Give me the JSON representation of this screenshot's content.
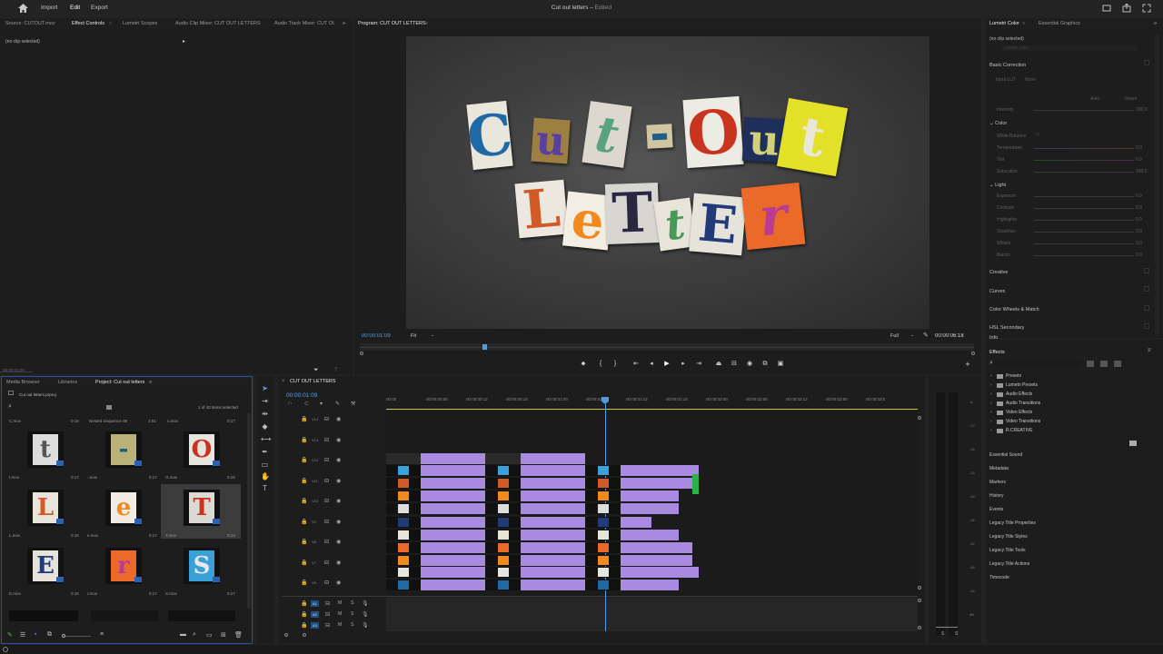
{
  "header": {
    "nav": [
      "Import",
      "Edit",
      "Export"
    ],
    "title": "Cut out letters",
    "title_status": "Edited"
  },
  "source_tabs": [
    "Source: CUTOUT.mov",
    "Effect Controls",
    "Lumetri Scopes",
    "Audio Clip Mixer: CUT OUT LETTERS",
    "Audio Track Mixer: CUT OUT"
  ],
  "effect_controls": {
    "no_clip": "(no clip selected)",
    "timecode": "00:00:01:09"
  },
  "program": {
    "tab": "Program: CUT OUT LETTERS",
    "timecode": "00:00:01:09",
    "fit": "Fit",
    "quality": "Full",
    "duration": "00:00:06:18",
    "words": [
      "Cut",
      "Out",
      "Letter"
    ]
  },
  "lumetri": {
    "tabs": [
      "Lumetri Color",
      "Essential Graphics"
    ],
    "no_clip": "(no clip selected)",
    "clip_field": "Lumetri Color",
    "basic_correction": "Basic Correction",
    "input_lut_label": "Input LUT",
    "input_lut_value": "None",
    "auto_btn": "Auto",
    "reset_btn": "Reset",
    "intensity_label": "Intensity",
    "intensity_value": "100.0",
    "color_section": "Color",
    "white_balance": "White Balance",
    "color_rows": [
      {
        "label": "Temperature",
        "value": "0.0"
      },
      {
        "label": "Tint",
        "value": "0.0"
      },
      {
        "label": "Saturation",
        "value": "100.0"
      }
    ],
    "light_section": "Light",
    "light_rows": [
      {
        "label": "Exposure",
        "value": "0.0"
      },
      {
        "label": "Contrast",
        "value": "0.0"
      },
      {
        "label": "Highlights",
        "value": "0.0"
      },
      {
        "label": "Shadows",
        "value": "0.0"
      },
      {
        "label": "Whites",
        "value": "0.0"
      },
      {
        "label": "Blacks",
        "value": "0.0"
      }
    ],
    "sections": [
      "Creative",
      "Curves",
      "Color Wheels & Match",
      "HSL Secondary"
    ]
  },
  "right_panel": {
    "info": "Info",
    "effects": "Effects",
    "effects_tree": [
      "Presets",
      "Lumetri Presets",
      "Audio Effects",
      "Audio Transitions",
      "Video Effects",
      "Video Transitions",
      "R.CREATIVE"
    ],
    "panels": [
      "Essential Sound",
      "Metadata",
      "Markers",
      "History",
      "Events",
      "Legacy Title Properties",
      "Legacy Title Styles",
      "Legacy Title Tools",
      "Legacy Title Actions",
      "Timecode"
    ]
  },
  "project": {
    "tabs": [
      "Media Browser",
      "Libraries",
      "Project: Cut out letters"
    ],
    "file": "Cut out letters.prproj",
    "selected": "1 of 42 items selected",
    "top_row": [
      {
        "name": "C.mov",
        "dur": "0:16"
      },
      {
        "name": "Nested Sequence 05",
        "dur": "2:01"
      },
      {
        "name": "u.mov",
        "dur": "0:17"
      }
    ],
    "items": [
      {
        "name": "t.mov",
        "dur": "0:17",
        "glyph": "t"
      },
      {
        "name": "-.mov",
        "dur": "0:17",
        "glyph": "-"
      },
      {
        "name": "O.mov",
        "dur": "0:16",
        "glyph": "O"
      },
      {
        "name": "L.mov",
        "dur": "0:16",
        "glyph": "L"
      },
      {
        "name": "e.mov",
        "dur": "0:17",
        "glyph": "e"
      },
      {
        "name": "T.mov",
        "dur": "0:13",
        "glyph": "T"
      },
      {
        "name": "E.mov",
        "dur": "0:16",
        "glyph": "E"
      },
      {
        "name": "r.mov",
        "dur": "0:17",
        "glyph": "r"
      },
      {
        "name": "S.mov",
        "dur": "0:17",
        "glyph": "S"
      }
    ]
  },
  "timeline": {
    "tab": "CUT OUT LETTERS",
    "timecode": "00:00:01:09",
    "ruler": [
      "00:00",
      "00:00:00:06",
      "00:00:00:12",
      "00:00:00:18",
      "00:00:01:00",
      "00:00:01:06",
      "00:00:01:12",
      "00:00:01:18",
      "00:00:02:00",
      "00:00:02:06",
      "00:00:02:12",
      "00:00:03:00",
      "00:00:03:0"
    ],
    "video_tracks": [
      "V14",
      "V13",
      "V12",
      "V11",
      "V10",
      "V9",
      "V8",
      "V7",
      "V6"
    ],
    "audio_tracks": [
      "A1",
      "A2",
      "A3"
    ]
  },
  "meter": {
    "scale": [
      "-6",
      "-12",
      "-18",
      "-24",
      "-30",
      "-36",
      "-42",
      "-48",
      "-54",
      "dB"
    ],
    "solo": [
      "S",
      "S"
    ]
  },
  "colors": {
    "accent": "#3a8dde",
    "clip": "#a88ae0",
    "playhead": "#4a9fe8",
    "focus": "#2c4fa8"
  }
}
